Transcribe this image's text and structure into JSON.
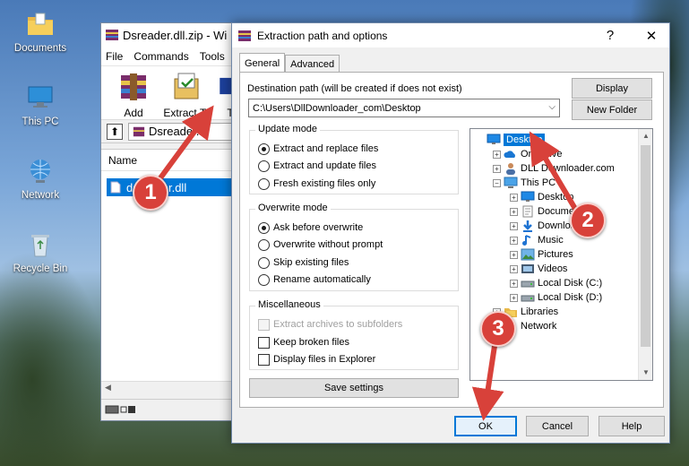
{
  "desktop": {
    "icons": [
      {
        "label": "Documents",
        "icon": "folder-icon"
      },
      {
        "label": "This PC",
        "icon": "computer-icon"
      },
      {
        "label": "Network",
        "icon": "network-icon"
      },
      {
        "label": "Recycle Bin",
        "icon": "recycle-bin-icon"
      }
    ]
  },
  "winrar": {
    "title": "Dsreader.dll.zip - Wi",
    "menu": [
      "File",
      "Commands",
      "Tools"
    ],
    "toolbar": {
      "add_label": "Add",
      "extract_label": "Extract To",
      "third_label": "T"
    },
    "path_text": "Dsreader.dl",
    "column_name": "Name",
    "file_row": "dsreader.dll"
  },
  "dialog": {
    "title": "Extraction path and options",
    "help_glyph": "?",
    "close_glyph": "✕",
    "tabs": [
      "General",
      "Advanced"
    ],
    "dest_label": "Destination path (will be created if does not exist)",
    "dest_value": "C:\\Users\\DllDownloader_com\\Desktop",
    "display_button": "Display",
    "new_folder_button": "New Folder",
    "update_mode": {
      "title": "Update mode",
      "options": [
        "Extract and replace files",
        "Extract and update files",
        "Fresh existing files only"
      ],
      "selected": 0
    },
    "overwrite_mode": {
      "title": "Overwrite mode",
      "options": [
        "Ask before overwrite",
        "Overwrite without prompt",
        "Skip existing files",
        "Rename automatically"
      ],
      "selected": 0
    },
    "misc": {
      "title": "Miscellaneous",
      "options": [
        "Extract archives to subfolders",
        "Keep broken files",
        "Display files in Explorer"
      ]
    },
    "save_settings": "Save settings",
    "ok": "OK",
    "cancel": "Cancel",
    "help": "Help",
    "tree": [
      {
        "label": "Desktop",
        "indent": 0,
        "icon": "desktop-icon",
        "selected": true,
        "expander": "none"
      },
      {
        "label": "OneDrive",
        "indent": 1,
        "icon": "onedrive-icon",
        "expander": "+"
      },
      {
        "label": "DLL Downloader.com",
        "indent": 1,
        "icon": "user-icon",
        "expander": "+"
      },
      {
        "label": "This PC",
        "indent": 1,
        "icon": "computer-icon",
        "expander": "-"
      },
      {
        "label": "Desktop",
        "indent": 2,
        "icon": "desktop-icon",
        "expander": "+"
      },
      {
        "label": "Documents",
        "indent": 2,
        "icon": "documents-icon",
        "expander": "+"
      },
      {
        "label": "Downloads",
        "indent": 2,
        "icon": "downloads-icon",
        "expander": "+"
      },
      {
        "label": "Music",
        "indent": 2,
        "icon": "music-icon",
        "expander": "+"
      },
      {
        "label": "Pictures",
        "indent": 2,
        "icon": "pictures-icon",
        "expander": "+"
      },
      {
        "label": "Videos",
        "indent": 2,
        "icon": "videos-icon",
        "expander": "+"
      },
      {
        "label": "Local Disk (C:)",
        "indent": 2,
        "icon": "disk-icon",
        "expander": "+"
      },
      {
        "label": "Local Disk (D:)",
        "indent": 2,
        "icon": "disk-icon",
        "expander": "+"
      },
      {
        "label": "Libraries",
        "indent": 1,
        "icon": "library-icon",
        "expander": "+"
      },
      {
        "label": "Network",
        "indent": 1,
        "icon": "network-icon",
        "expander": "+"
      }
    ]
  },
  "annotations": [
    "1",
    "2",
    "3"
  ],
  "colors": {
    "accent": "#0078d7",
    "badge": "#d8413a"
  }
}
